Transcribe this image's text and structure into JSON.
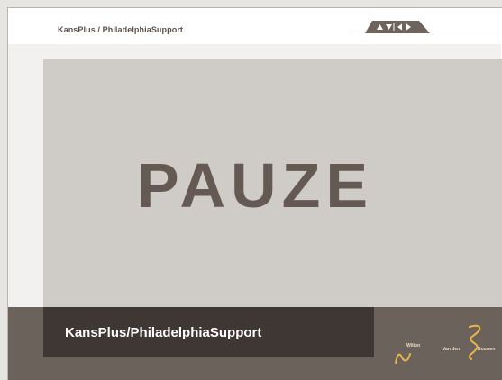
{
  "header": {
    "breadcrumb": "KansPlus / PhiladelphiaSupport"
  },
  "nav": {
    "buttons": [
      {
        "name": "up-arrow-icon"
      },
      {
        "name": "down-arrow-icon"
      },
      {
        "name": "previous-arrow-icon"
      },
      {
        "name": "next-arrow-icon"
      }
    ]
  },
  "main": {
    "pause_label": "PAUZE"
  },
  "footer": {
    "title": "KansPlus/PhiladelphiaSupport",
    "logo": {
      "word_left": "Wilton",
      "word_middle": "Van den",
      "word_right": "Bouwen"
    }
  },
  "colors": {
    "frame": "#f2f1ef",
    "pause_background": "#cfcbc6",
    "pause_text": "#655a53",
    "footer": "#6b625c",
    "footer_title_box": "#3e3733",
    "logo_gold": "#e8b54a"
  }
}
